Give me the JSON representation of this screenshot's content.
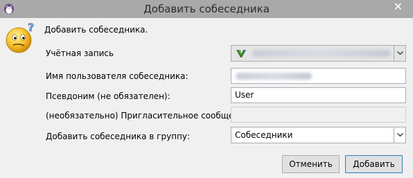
{
  "window": {
    "title": "Добавить собеседника",
    "close_glyph": "✕"
  },
  "dialog": {
    "heading": "Добавить собеседника."
  },
  "form": {
    "account_label": "Учётная запись",
    "username_label": "Имя пользователя собеседника:",
    "alias_label": "Псевдоним (не обязателен):",
    "alias_value": "User",
    "invite_label": "(необязательно) Пригласительное сообщение:",
    "invite_value": "",
    "group_label": "Добавить собеседника в группу:",
    "group_value": "Собеседники"
  },
  "buttons": {
    "cancel_label": "Отменить",
    "add_label": "Добавить"
  },
  "icons": {
    "app": "pidgin-penguin-icon",
    "dialog": "confused-smiley-icon",
    "account": "vk-logo-icon",
    "dropdown": "chevron-down-icon",
    "close": "close-icon"
  },
  "colors": {
    "titlebar": "#a9a9a9",
    "dialog_bg": "#f0f0f0",
    "default_button_border": "#3c7fb1"
  }
}
